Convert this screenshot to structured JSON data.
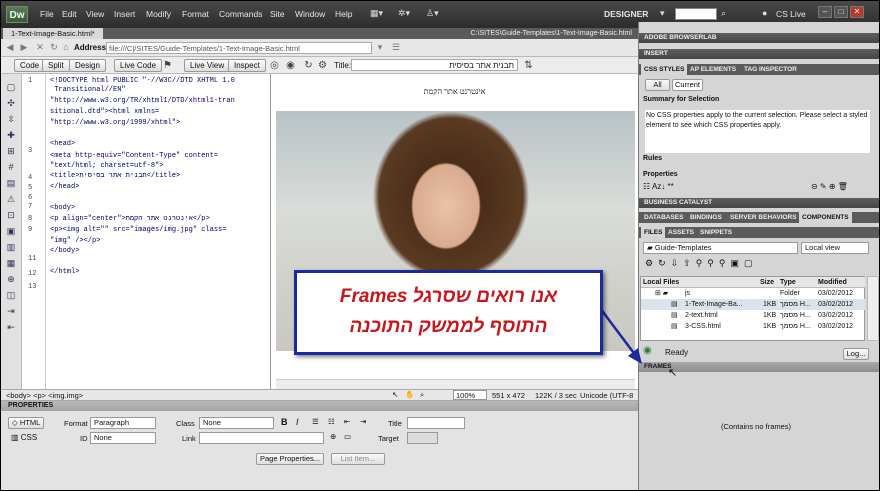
{
  "app": {
    "logo": "Dw",
    "menus": [
      "File",
      "Edit",
      "View",
      "Insert",
      "Modify",
      "Format",
      "Commands",
      "Site",
      "Window",
      "Help"
    ],
    "workspace": "DESIGNER",
    "cs_live": "CS Live"
  },
  "doc": {
    "tab": "1-Text-Image-Basic.html*",
    "path": "C:\\SITES\\Guide-Templates\\1-Text-Image-Basic.html",
    "address_label": "Address:",
    "address": "file:///C|/SITES/Guide-Templates/1-Text-Image-Basic.html"
  },
  "toolbar": {
    "code": "Code",
    "split": "Split",
    "design": "Design",
    "live_code": "Live Code",
    "live_view": "Live View",
    "inspect": "Inspect",
    "title_label": "Title:",
    "title_value": "תבנית אתר בסיסית"
  },
  "code": {
    "line_numbers": [
      "1",
      "",
      "",
      "",
      "",
      "2",
      "3",
      "",
      "4",
      "5",
      "6",
      "7",
      "8",
      "9",
      "10",
      "",
      "11",
      "12",
      "13"
    ],
    "lines": [
      "<!DOCTYPE html PUBLIC \"-//W3C//DTD XHTML 1.0",
      " Transitional//EN\"",
      "\"http://www.w3.org/TR/xhtml1/DTD/xhtml1-tran",
      "sitional.dtd\"><html xmlns=",
      "\"http://www.w3.org/1999/xhtml\">",
      "",
      "<head>",
      "<meta http-equiv=\"Content-Type\" content=",
      "\"text/html; charset=utf-8\">",
      "<title>תבנית אתר בסיסית</title>",
      "</head>",
      "",
      "<body>",
      "<p align=\"center\">אינטרנט אתר הקמת</p>",
      "<p><img alt=\"\" src=\"images/img.jpg\" class=",
      "\"img\" /></p>",
      "</body>",
      "",
      "</html>"
    ]
  },
  "design": {
    "heading": "אינטרנט אתר הקמת"
  },
  "status": {
    "tags": "<body> <p> <img.img>",
    "zoom": "100%",
    "size": "551 x 472",
    "file": "122K / 3 sec",
    "encoding": "Unicode (UTF-8"
  },
  "properties": {
    "header": "PROPERTIES",
    "html": "HTML",
    "css": "CSS",
    "format_label": "Format",
    "format_value": "Paragraph",
    "class_label": "Class",
    "class_value": "None",
    "id_label": "ID",
    "id_value": "None",
    "link_label": "Link",
    "title_label": "Title",
    "target_label": "Target",
    "page_props": "Page Properties...",
    "list_item": "List Item...",
    "bold": "B",
    "italic": "I"
  },
  "panels": {
    "browserlab": "ADOBE BROWSERLAB",
    "insert": "INSERT",
    "css_tabs": [
      "CSS STYLES",
      "AP ELEMENTS",
      "TAG INSPECTOR"
    ],
    "all": "All",
    "current": "Current",
    "summary": "Summary for Selection",
    "summary_text": "No CSS properties apply to the current selection.  Please select a styled element to see which CSS properties apply.",
    "rules": "Rules",
    "properties": "Properties",
    "business": "BUSINESS CATALYST",
    "db_tabs": [
      "DATABASES",
      "BINDINGS",
      "SERVER BEHAVIORS",
      "COMPONENTS"
    ],
    "files_tabs": [
      "FILES",
      "ASSETS",
      "SNIPPETS"
    ],
    "site": "Guide-Templates",
    "view": "Local view",
    "cols": [
      "Local Files",
      "Size",
      "Type",
      "Modified"
    ],
    "rows": [
      {
        "name": "js",
        "size": "",
        "type": "Folder",
        "mod": "03/02/2012"
      },
      {
        "name": "1-Text-Image-Ba...",
        "size": "1KB",
        "type": "מסמך H...",
        "mod": "03/02/2012"
      },
      {
        "name": "2-text.html",
        "size": "1KB",
        "type": "מסמך H...",
        "mod": "03/02/2012"
      },
      {
        "name": "3-CSS.html",
        "size": "1KB",
        "type": "מסמך H...",
        "mod": "03/02/2012"
      }
    ],
    "ready": "Ready",
    "log": "Log...",
    "frames": "FRAMES",
    "no_frames": "(Contains no frames)"
  },
  "callout": {
    "line1": "אנו רואים שסרגל Frames",
    "line2": "התוסף לממשק התוכנה"
  },
  "colors": {
    "menubar": "#333333",
    "callout_text": "#c8161b",
    "callout_border": "#1a2a9c"
  }
}
